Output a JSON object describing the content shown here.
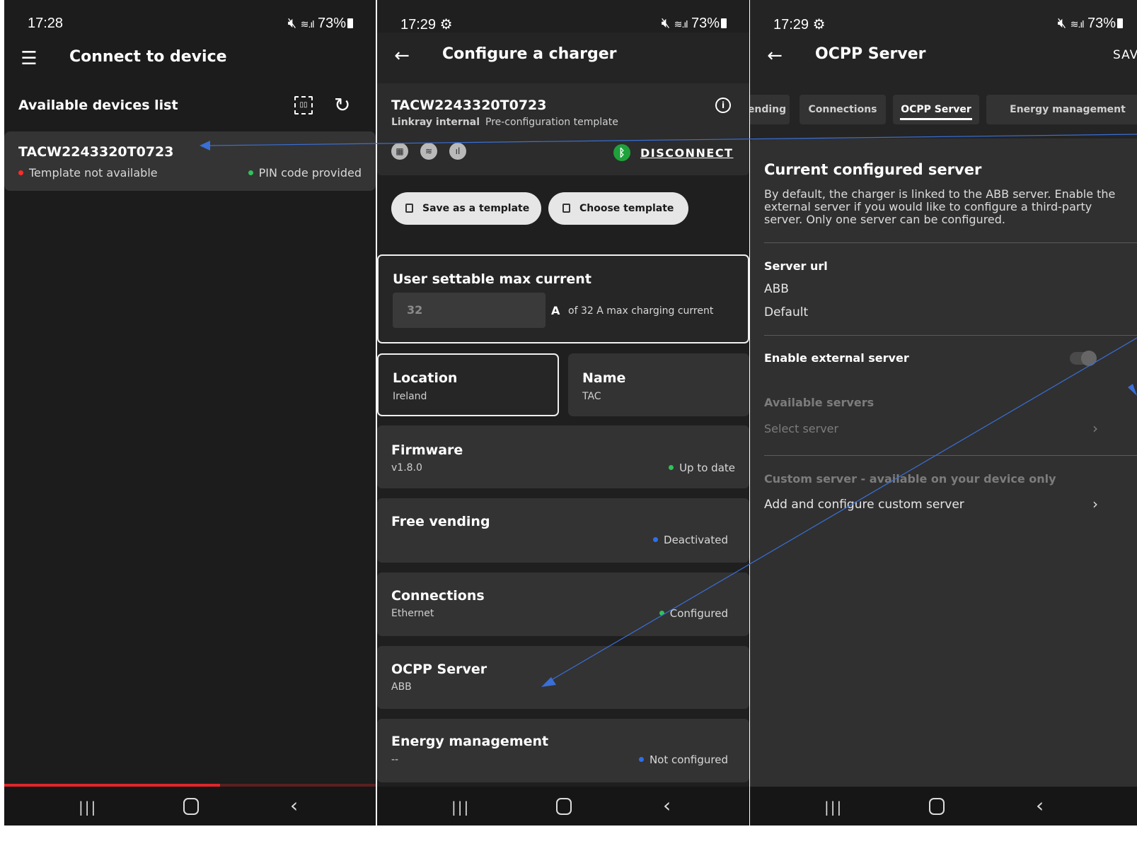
{
  "colors": {
    "accent_blue": "#2f6fe6",
    "status_green": "#2ec35a",
    "status_red": "#ff2a2a",
    "bluetooth_green": "#1fa13b",
    "progress_red": "#e0262a",
    "annotation_blue": "#3a6fd6"
  },
  "screen1": {
    "status": {
      "time": "17:28",
      "battery": "73%"
    },
    "title": "Connect to device",
    "list_header": "Available devices list",
    "device": {
      "name": "TACW2243320T0723",
      "template_status": "Template not available",
      "pin_status": "PIN code provided"
    },
    "progress": 0.58
  },
  "screen2": {
    "status": {
      "time": "17:29",
      "battery": "73%"
    },
    "title": "Configure a charger",
    "device": {
      "name": "TACW2243320T0723",
      "org": "Linkray internal",
      "template": "Pre-configuration template"
    },
    "disconnect": "DISCONNECT",
    "save_template": "Save as a template",
    "choose_template": "Choose template",
    "max_current": {
      "title": "User settable max current",
      "value": "32",
      "unit": "A",
      "note": "of 32 A max charging current"
    },
    "location": {
      "title": "Location",
      "value": "Ireland"
    },
    "name": {
      "title": "Name",
      "value": "TAC"
    },
    "firmware": {
      "title": "Firmware",
      "value": "v1.8.0",
      "status": "Up to date"
    },
    "free_vending": {
      "title": "Free vending",
      "status": "Deactivated"
    },
    "connections": {
      "title": "Connections",
      "value": "Ethernet",
      "status": "Configured"
    },
    "ocpp": {
      "title": "OCPP Server",
      "value": "ABB"
    },
    "energy": {
      "title": "Energy management",
      "value": "--",
      "status": "Not configured"
    }
  },
  "screen3": {
    "status": {
      "time": "17:29",
      "battery": "73%"
    },
    "title": "OCPP Server",
    "save": "SAVE",
    "tabs": [
      "ending",
      "Connections",
      "OCPP Server",
      "Energy management"
    ],
    "heading": "Current configured server",
    "description": "By default, the charger is linked to the ABB server. Enable the external server if you would like to configure a third-party server. Only one server can be configured.",
    "server_url_label": "Server url",
    "server_url_value": "ABB",
    "server_url_default": "Default",
    "enable_external": "Enable external server",
    "external_enabled": false,
    "available_servers": "Available servers",
    "select_server": "Select server",
    "custom_server": "Custom server - available on your device only",
    "add_custom": "Add and configure custom server"
  }
}
